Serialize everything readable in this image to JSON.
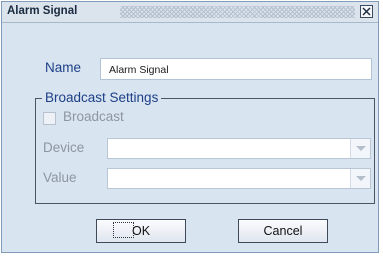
{
  "window": {
    "title": "Alarm Signal",
    "close_glyph": "close-icon"
  },
  "form": {
    "name_label": "Name",
    "name_value": "Alarm Signal",
    "broadcast_group_title": "Broadcast Settings",
    "broadcast_label": "Broadcast",
    "broadcast_checked": false,
    "device_label": "Device",
    "device_value": "",
    "value_label": "Value",
    "value_value": ""
  },
  "buttons": {
    "ok_label": "OK",
    "cancel_label": "Cancel"
  },
  "colors": {
    "dialog_bg": "#d9e4f1",
    "label_blue": "#1c3f86",
    "disabled_text": "#8d95a1"
  }
}
